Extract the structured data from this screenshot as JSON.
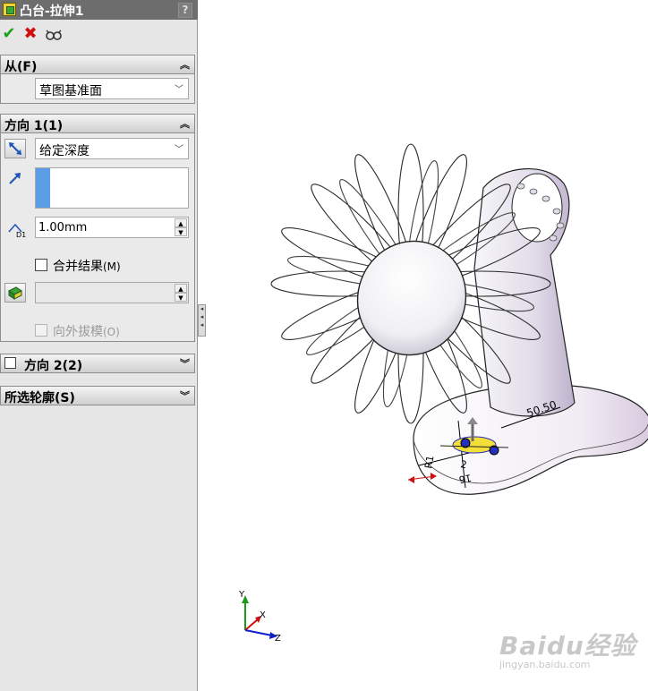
{
  "property_manager": {
    "title": "凸台-拉伸1",
    "help": "?",
    "actions": {
      "ok_icon": "✔",
      "cancel_icon": "✖",
      "preview_icon": "66"
    },
    "from": {
      "header": "从(F)",
      "start_condition": "草图基准面"
    },
    "direction1": {
      "header": "方向 1(1)",
      "end_condition": "给定深度",
      "depth": "1.00mm",
      "merge_result_label": "合并结果",
      "merge_result_key": "(M)",
      "merge_result_checked": false,
      "draft_outward_label": "向外拔模",
      "draft_outward_key": "(O)"
    },
    "direction2": {
      "header": "方向 2(2)",
      "checked": false
    },
    "selected_contours": {
      "header": "所选轮廓(S)"
    }
  },
  "viewport": {
    "dimensions": [
      "50.50",
      "R1",
      "2",
      "16"
    ],
    "triad": {
      "x": "X",
      "y": "Y",
      "z": "Z"
    }
  },
  "watermark": {
    "main": "Baidu经验",
    "sub": "jingyan.baidu.com"
  }
}
